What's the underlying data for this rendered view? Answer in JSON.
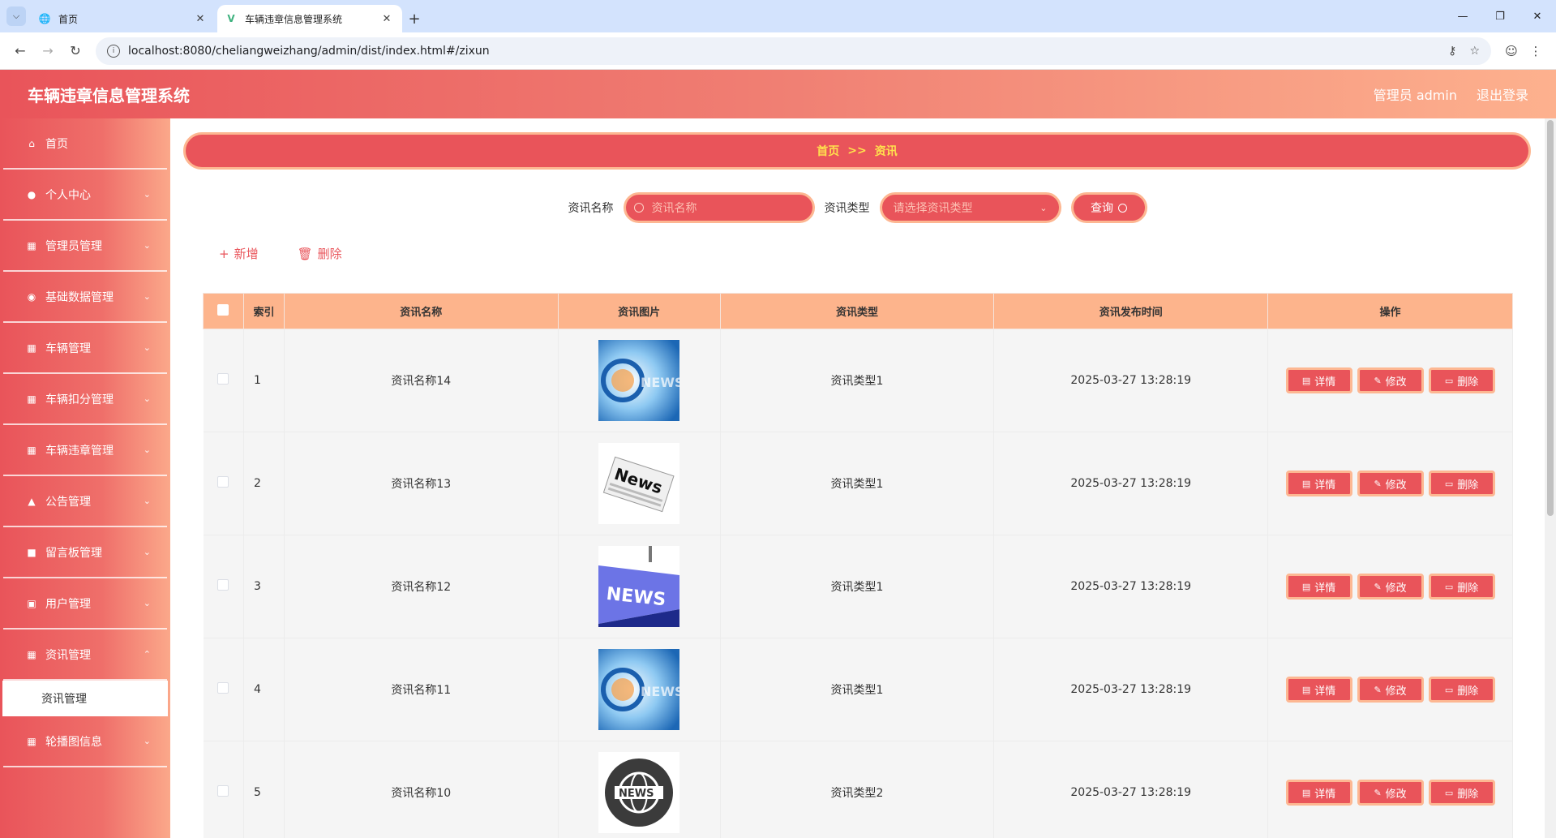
{
  "browser": {
    "tabs": [
      {
        "title": "首页",
        "active": false
      },
      {
        "title": "车辆违章信息管理系统",
        "active": true
      }
    ],
    "url": "localhost:8080/cheliangweizhang/admin/dist/index.html#/zixun"
  },
  "header": {
    "title": "车辆违章信息管理系统",
    "user": "管理员 admin",
    "logout": "退出登录"
  },
  "sidebar": {
    "items": [
      {
        "label": "首页",
        "icon": "home-icon"
      },
      {
        "label": "个人中心",
        "icon": "user-icon"
      },
      {
        "label": "管理员管理",
        "icon": "grid-icon"
      },
      {
        "label": "基础数据管理",
        "icon": "pin-icon"
      },
      {
        "label": "车辆管理",
        "icon": "grid-icon"
      },
      {
        "label": "车辆扣分管理",
        "icon": "grid-icon"
      },
      {
        "label": "车辆违章管理",
        "icon": "grid-icon"
      },
      {
        "label": "公告管理",
        "icon": "thumb-icon"
      },
      {
        "label": "留言板管理",
        "icon": "message-icon"
      },
      {
        "label": "用户管理",
        "icon": "briefcase-icon"
      },
      {
        "label": "资讯管理",
        "icon": "grid-icon"
      },
      {
        "label": "轮播图信息",
        "icon": "grid-icon"
      }
    ],
    "submenu": {
      "label": "资讯管理"
    }
  },
  "breadcrumb": {
    "home": "首页",
    "separator": ">>",
    "current": "资讯"
  },
  "search": {
    "name_label": "资讯名称",
    "name_placeholder": "资讯名称",
    "type_label": "资讯类型",
    "type_placeholder": "请选择资讯类型",
    "button": "查询"
  },
  "actions": {
    "add": "新增",
    "delete": "删除"
  },
  "table": {
    "columns": [
      "索引",
      "资讯名称",
      "资讯图片",
      "资讯类型",
      "资讯发布时间",
      "操作"
    ],
    "rows": [
      {
        "index": "1",
        "name": "资讯名称14",
        "image": "news-globe",
        "type": "资讯类型1",
        "time": "2025-03-27 13:28:19"
      },
      {
        "index": "2",
        "name": "资讯名称13",
        "image": "news-paper",
        "type": "资讯类型1",
        "time": "2025-03-27 13:28:19"
      },
      {
        "index": "3",
        "name": "资讯名称12",
        "image": "news-key",
        "type": "资讯类型1",
        "time": "2025-03-27 13:28:19"
      },
      {
        "index": "4",
        "name": "资讯名称11",
        "image": "news-globe",
        "type": "资讯类型1",
        "time": "2025-03-27 13:28:19"
      },
      {
        "index": "5",
        "name": "资讯名称10",
        "image": "news-circle",
        "type": "资讯类型2",
        "time": "2025-03-27 13:28:19"
      }
    ],
    "row_actions": {
      "detail": "详情",
      "edit": "修改",
      "delete": "删除"
    }
  },
  "colors": {
    "primary": "#e9545a",
    "accent_border": "#fdb792",
    "header_bg": "#fdb48c",
    "breadcrumb_text": "#ffe14d"
  }
}
